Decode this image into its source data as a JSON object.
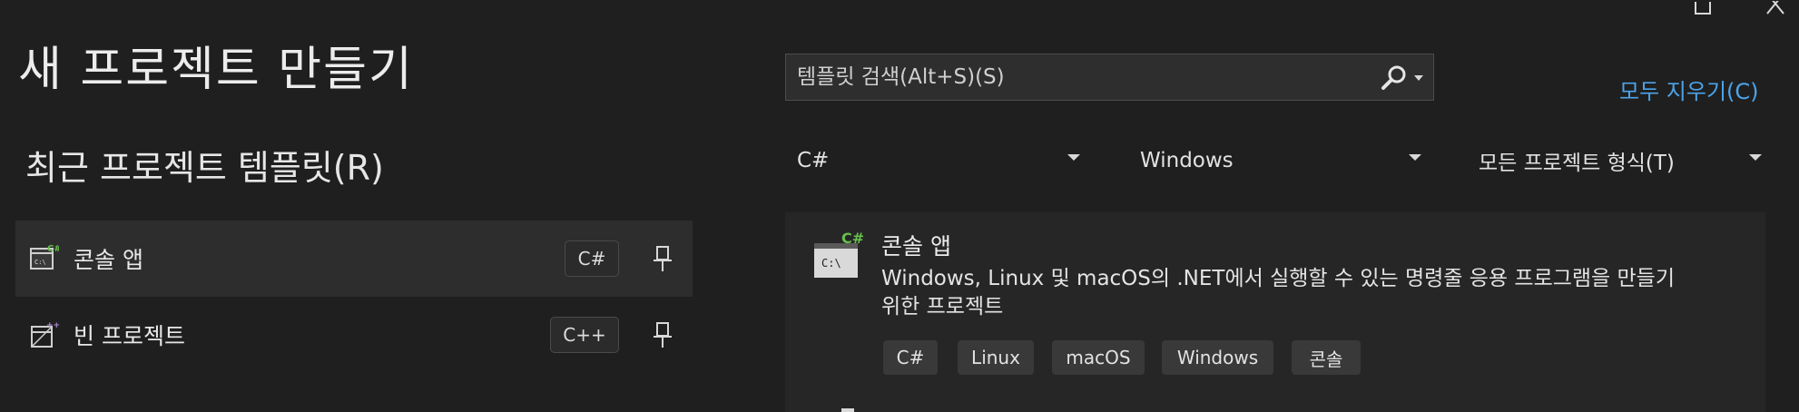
{
  "page": {
    "title": "새 프로젝트 만들기",
    "recent_heading": "최근 프로젝트 템플릿(R)"
  },
  "recent_templates": [
    {
      "label": "콘솔 앱",
      "language": "C#",
      "selected": true,
      "icon": "console-app-icon"
    },
    {
      "label": "빈 프로젝트",
      "language": "C++",
      "selected": false,
      "icon": "empty-project-icon"
    }
  ],
  "search": {
    "placeholder": "템플릿 검색(Alt+S)(S)"
  },
  "clear_all_label": "모두 지우기(C)",
  "filters": {
    "language": "C#",
    "platform": "Windows",
    "project_type": "모든 프로젝트 형식(T)"
  },
  "templates": [
    {
      "name": "콘솔 앱",
      "description": "Windows, Linux 및 macOS의 .NET에서 실행할 수 있는 명령줄 응용 프로그램을 만들기 위한 프로젝트",
      "tags": [
        "C#",
        "Linux",
        "macOS",
        "Windows",
        "콘솔"
      ],
      "icon_badge": "C#",
      "icon_screen_text": "C:\\"
    }
  ],
  "colors": {
    "background": "#1f1f1f",
    "accent_link": "#4da3e8",
    "csharp_green": "#68c04b",
    "cpp_purple": "#b38bd9"
  }
}
